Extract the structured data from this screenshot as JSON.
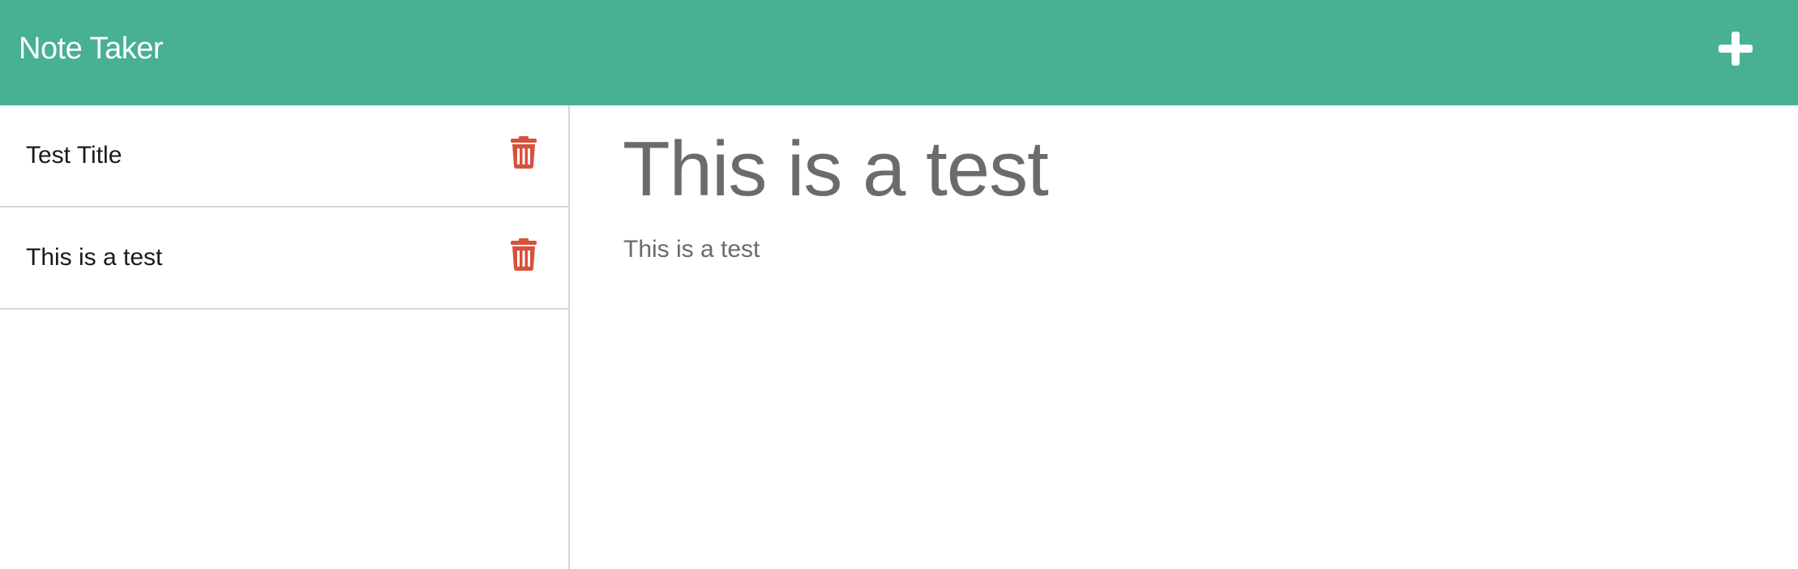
{
  "app": {
    "title": "Note Taker"
  },
  "header": {
    "new_note_icon": "plus-icon"
  },
  "sidebar": {
    "notes": [
      {
        "title": "Test Title",
        "delete_icon": "trash-icon"
      },
      {
        "title": "This is a test",
        "delete_icon": "trash-icon"
      }
    ]
  },
  "active_note": {
    "title": "This is a test",
    "text": "This is a test"
  },
  "colors": {
    "navbar": "#48b093",
    "delete": "#d8513d",
    "text_muted": "#6b6b6b"
  }
}
